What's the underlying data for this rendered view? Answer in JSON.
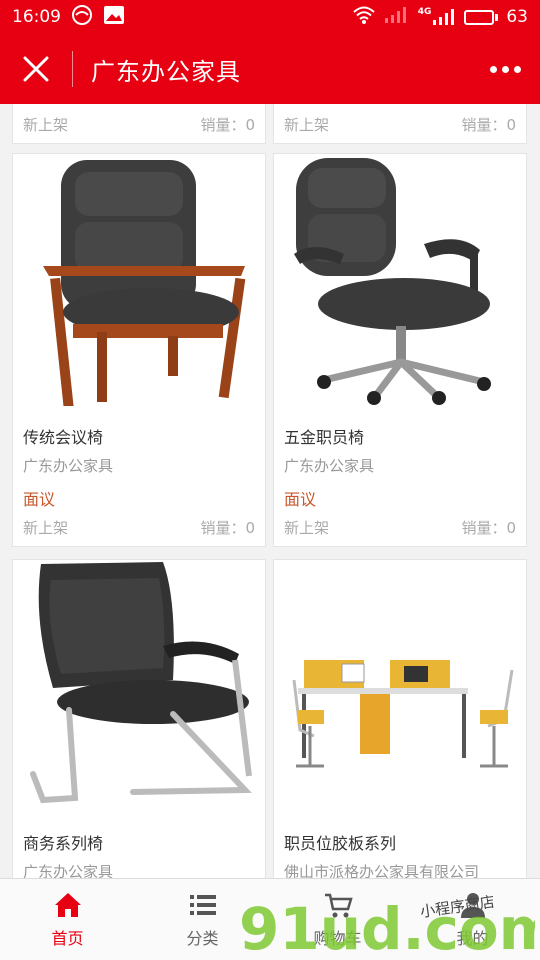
{
  "status_bar": {
    "time": "16:09",
    "network_label": "4G",
    "battery": "63",
    "battery_level": 0.63
  },
  "title_bar": {
    "title": "广东办公家具"
  },
  "top_row": [
    {
      "tag": "新上架",
      "sales": "销量：0"
    },
    {
      "tag": "新上架",
      "sales": "销量：0"
    }
  ],
  "products": [
    {
      "name": "传统会议椅",
      "shop": "广东办公家具",
      "price": "面议",
      "tag": "新上架",
      "sales": "销量：0",
      "image_icon": "wooden-leather-armchair-icon"
    },
    {
      "name": "五金职员椅",
      "shop": "广东办公家具",
      "price": "面议",
      "tag": "新上架",
      "sales": "销量：0",
      "image_icon": "swivel-office-chair-icon"
    },
    {
      "name": "商务系列椅",
      "shop": "广东办公家具",
      "image_icon": "cantilever-chair-icon"
    },
    {
      "name": "职员位胶板系列",
      "shop": "佛山市派格办公家具有限公司",
      "image_icon": "workstation-desk-icon"
    }
  ],
  "bottom_nav": [
    {
      "label": "首页",
      "icon": "home-icon",
      "active": true
    },
    {
      "label": "分类",
      "icon": "list-icon",
      "active": false
    },
    {
      "label": "购物车",
      "icon": "cart-icon",
      "active": false
    },
    {
      "label": "我的",
      "icon": "user-icon",
      "active": false
    }
  ],
  "watermark": {
    "text": "91ud.com",
    "subtext": "小程序商店"
  },
  "colors": {
    "brand": "#e60012",
    "price": "#c9572b"
  }
}
